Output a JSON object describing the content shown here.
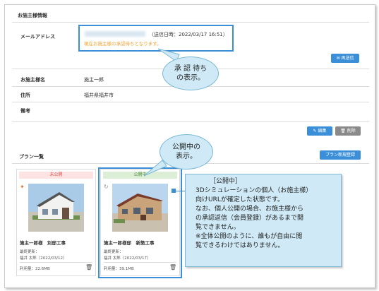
{
  "section_customer_info": "お施主様情報",
  "email_label": "メールアドレス",
  "email_sent_date": "（送信日時：2022/03/17 16:51）",
  "email_status": "現在お施主様の承認待ちとなります。",
  "resend_button": "再送信",
  "name_label": "お施主様名",
  "name_value": "施主一郎",
  "address_label": "住所",
  "address_value": "福井県福井市",
  "note_label": "備考",
  "edit_button": "編集",
  "delete_button": "削除",
  "callout_approval": [
    "承 認 待ち",
    "の表示。"
  ],
  "plan_list_title": "プラン一覧",
  "new_plan_button": "プラン新規登録",
  "callout_public": [
    "公開中の",
    "表示。"
  ],
  "cards": [
    {
      "status": "未公開",
      "title": "施主一郎様　別邸工事",
      "updated_label": "最終更新：",
      "updated_value": "福井 太郎（2022/03/12）",
      "usage": "利用量：22.6MB"
    },
    {
      "status": "公開中",
      "title": "施主一郎様邸　新築工事",
      "updated_label": "最終更新：",
      "updated_value": "福井 太郎（2022/03/17）",
      "usage": "利用量：39.1MB"
    }
  ],
  "explanation": [
    "［公開中］",
    "3Dシミュレーションの個人（お施主様）",
    "向けURLが確定した状態です。",
    "なお、個人公開の場合、お施主様から",
    "の承認返信（会員登録）があるまで閲",
    "覧できません。",
    "※全体公開のように、誰もが自由に閲",
    "覧できるわけではありません。"
  ],
  "colors": {
    "accent": "#3b8fd9",
    "warning_text": "#f0a030",
    "callout_bg": "#cfeaf6",
    "unpublished_badge": "#fde3e1",
    "published_badge": "#dcefd6"
  }
}
